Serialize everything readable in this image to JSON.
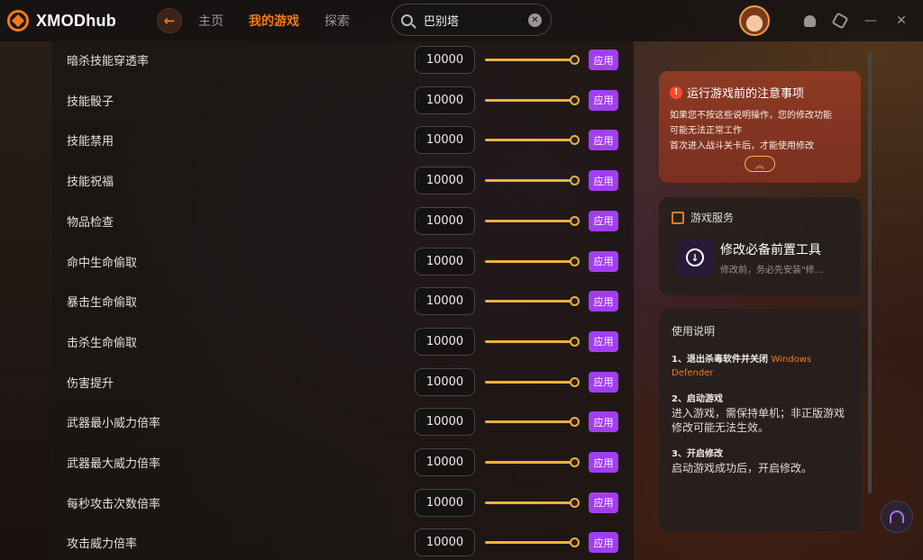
{
  "app": {
    "name": "XMODhub"
  },
  "nav": {
    "items": [
      {
        "label": "主页"
      },
      {
        "label": "我的游戏"
      },
      {
        "label": "探索"
      }
    ],
    "active_index": 1
  },
  "search": {
    "value": "巴别塔"
  },
  "colors": {
    "accent": "#f07a1a",
    "apply": "#a23ef0",
    "slider": "#f0b040"
  },
  "mods": [
    {
      "label": "暗杀技能穿透率",
      "value": "10000",
      "slider_fraction": 1.0,
      "apply": "应用"
    },
    {
      "label": "技能骰子",
      "value": "10000",
      "slider_fraction": 1.0,
      "apply": "应用"
    },
    {
      "label": "技能禁用",
      "value": "10000",
      "slider_fraction": 1.0,
      "apply": "应用"
    },
    {
      "label": "技能祝福",
      "value": "10000",
      "slider_fraction": 1.0,
      "apply": "应用"
    },
    {
      "label": "物品检查",
      "value": "10000",
      "slider_fraction": 1.0,
      "apply": "应用"
    },
    {
      "label": "命中生命偷取",
      "value": "10000",
      "slider_fraction": 1.0,
      "apply": "应用"
    },
    {
      "label": "暴击生命偷取",
      "value": "10000",
      "slider_fraction": 1.0,
      "apply": "应用"
    },
    {
      "label": "击杀生命偷取",
      "value": "10000",
      "slider_fraction": 1.0,
      "apply": "应用"
    },
    {
      "label": "伤害提升",
      "value": "10000",
      "slider_fraction": 1.0,
      "apply": "应用"
    },
    {
      "label": "武器最小威力倍率",
      "value": "10000",
      "slider_fraction": 1.0,
      "apply": "应用"
    },
    {
      "label": "武器最大威力倍率",
      "value": "10000",
      "slider_fraction": 1.0,
      "apply": "应用"
    },
    {
      "label": "每秒攻击次数倍率",
      "value": "10000",
      "slider_fraction": 1.0,
      "apply": "应用"
    },
    {
      "label": "攻击威力倍率",
      "value": "10000",
      "slider_fraction": 1.0,
      "apply": "应用"
    }
  ],
  "notice": {
    "title": "运行游戏前的注意事项",
    "line1": "如果您不按这些说明操作，您的修改功能",
    "line2": "可能无法正常工作",
    "line3": "首次进入战斗关卡后，才能使用修改"
  },
  "service": {
    "title": "游戏服务",
    "item_title": "修改必备前置工具",
    "item_sub": "修改前，务必先安装\"修..."
  },
  "usage": {
    "title": "使用说明",
    "step1_head": "1、退出杀毒软件并关闭",
    "step1_accent": "Windows Defender",
    "step2_head": "2、启动游戏",
    "step2_body": "进入游戏，需保持单机；非正版游戏修改可能无法生效。",
    "step3_head": "3、开启修改",
    "step3_body": "启动游戏成功后，开启修改。"
  }
}
